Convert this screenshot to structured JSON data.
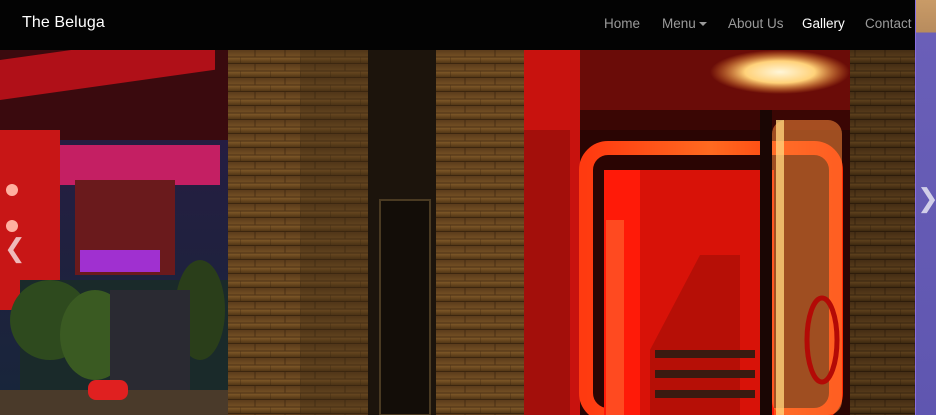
{
  "navbar": {
    "brand": "The Beluga",
    "links": [
      {
        "label": "Home"
      },
      {
        "label": "Menu"
      },
      {
        "label": "About Us"
      },
      {
        "label": "Gallery"
      },
      {
        "label": "Contact"
      }
    ]
  },
  "carousel": {
    "prev_icon": "chevron-left-icon",
    "next_icon": "chevron-right-icon",
    "slide_description_colors": {
      "brick": "#6b4a22",
      "neon_red": "#ff2a10",
      "glow": "#ffd27a"
    }
  }
}
